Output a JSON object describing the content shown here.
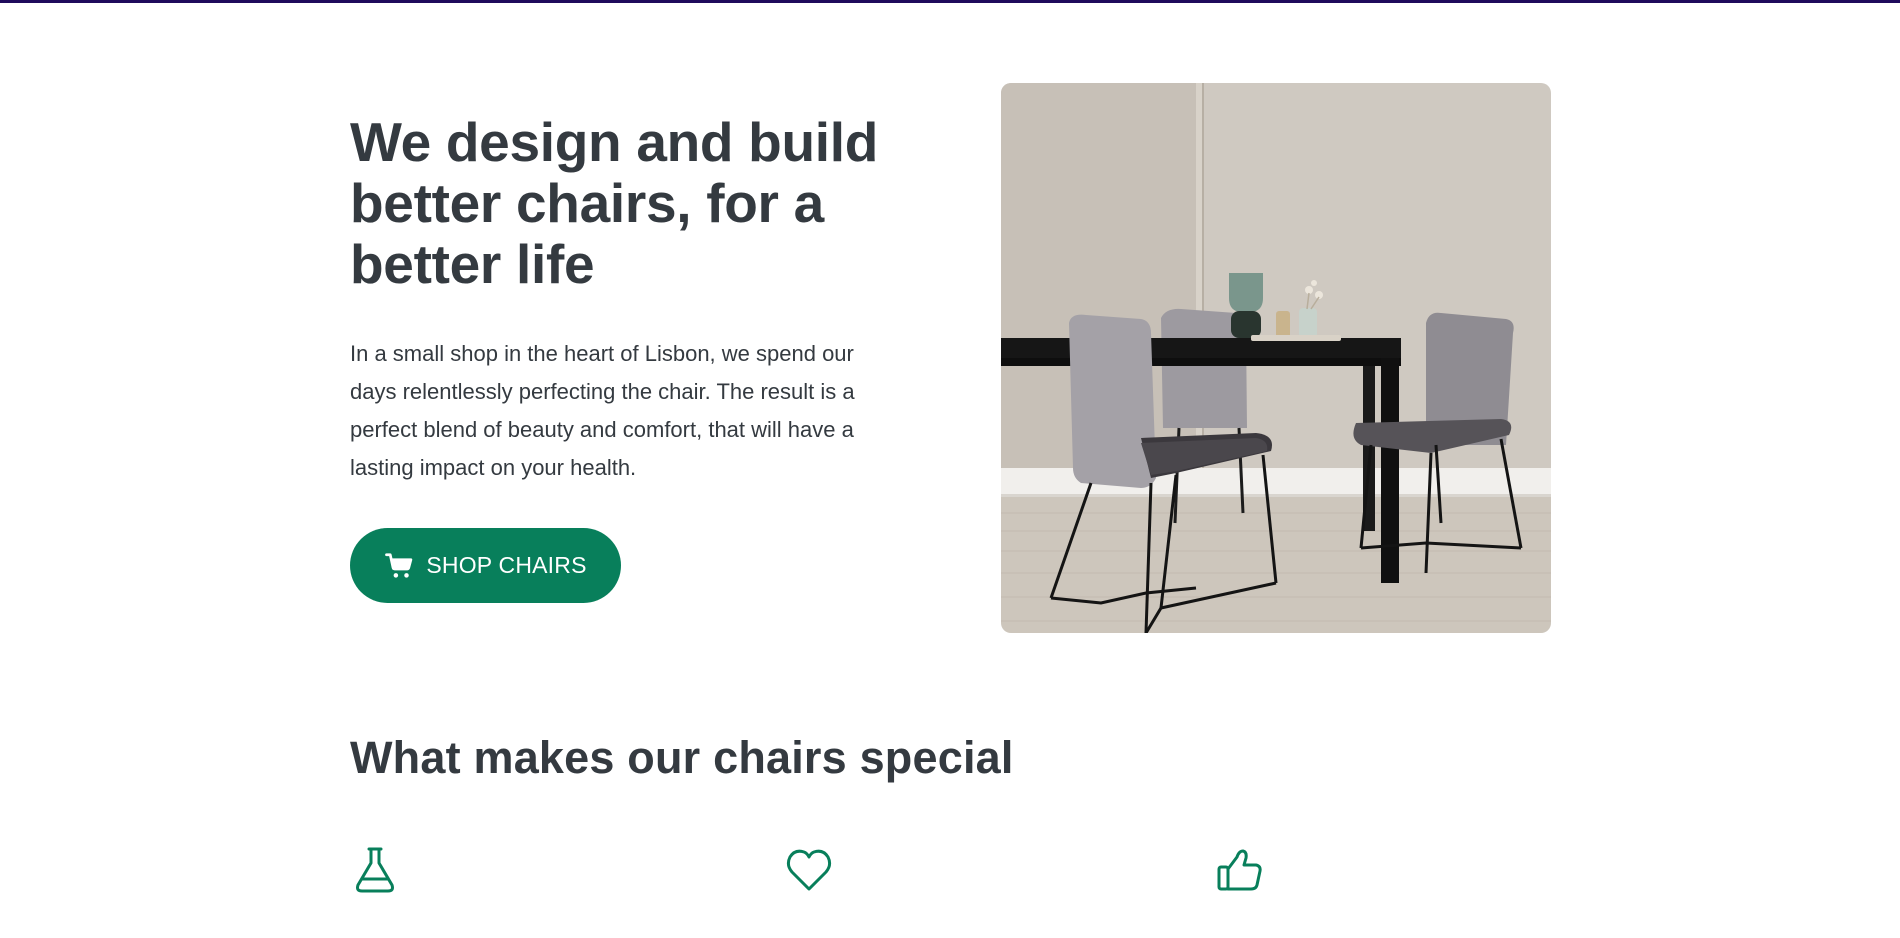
{
  "hero": {
    "title": "We design and build better chairs, for a better life",
    "description": "In a small shop in the heart of Lisbon, we spend our days relentlessly perfecting the chair. The result is a perfect blend of beauty and comfort, that will have a lasting impact on your health.",
    "button_label": "SHOP CHAIRS",
    "button_icon": "cart-icon"
  },
  "features": {
    "title": "What makes our chairs special",
    "icons": [
      "flask-icon",
      "heart-icon",
      "thumbs-up-icon"
    ]
  },
  "colors": {
    "accent": "#087f5b",
    "text": "#343a40",
    "top_bar": "#1f0b5c"
  }
}
